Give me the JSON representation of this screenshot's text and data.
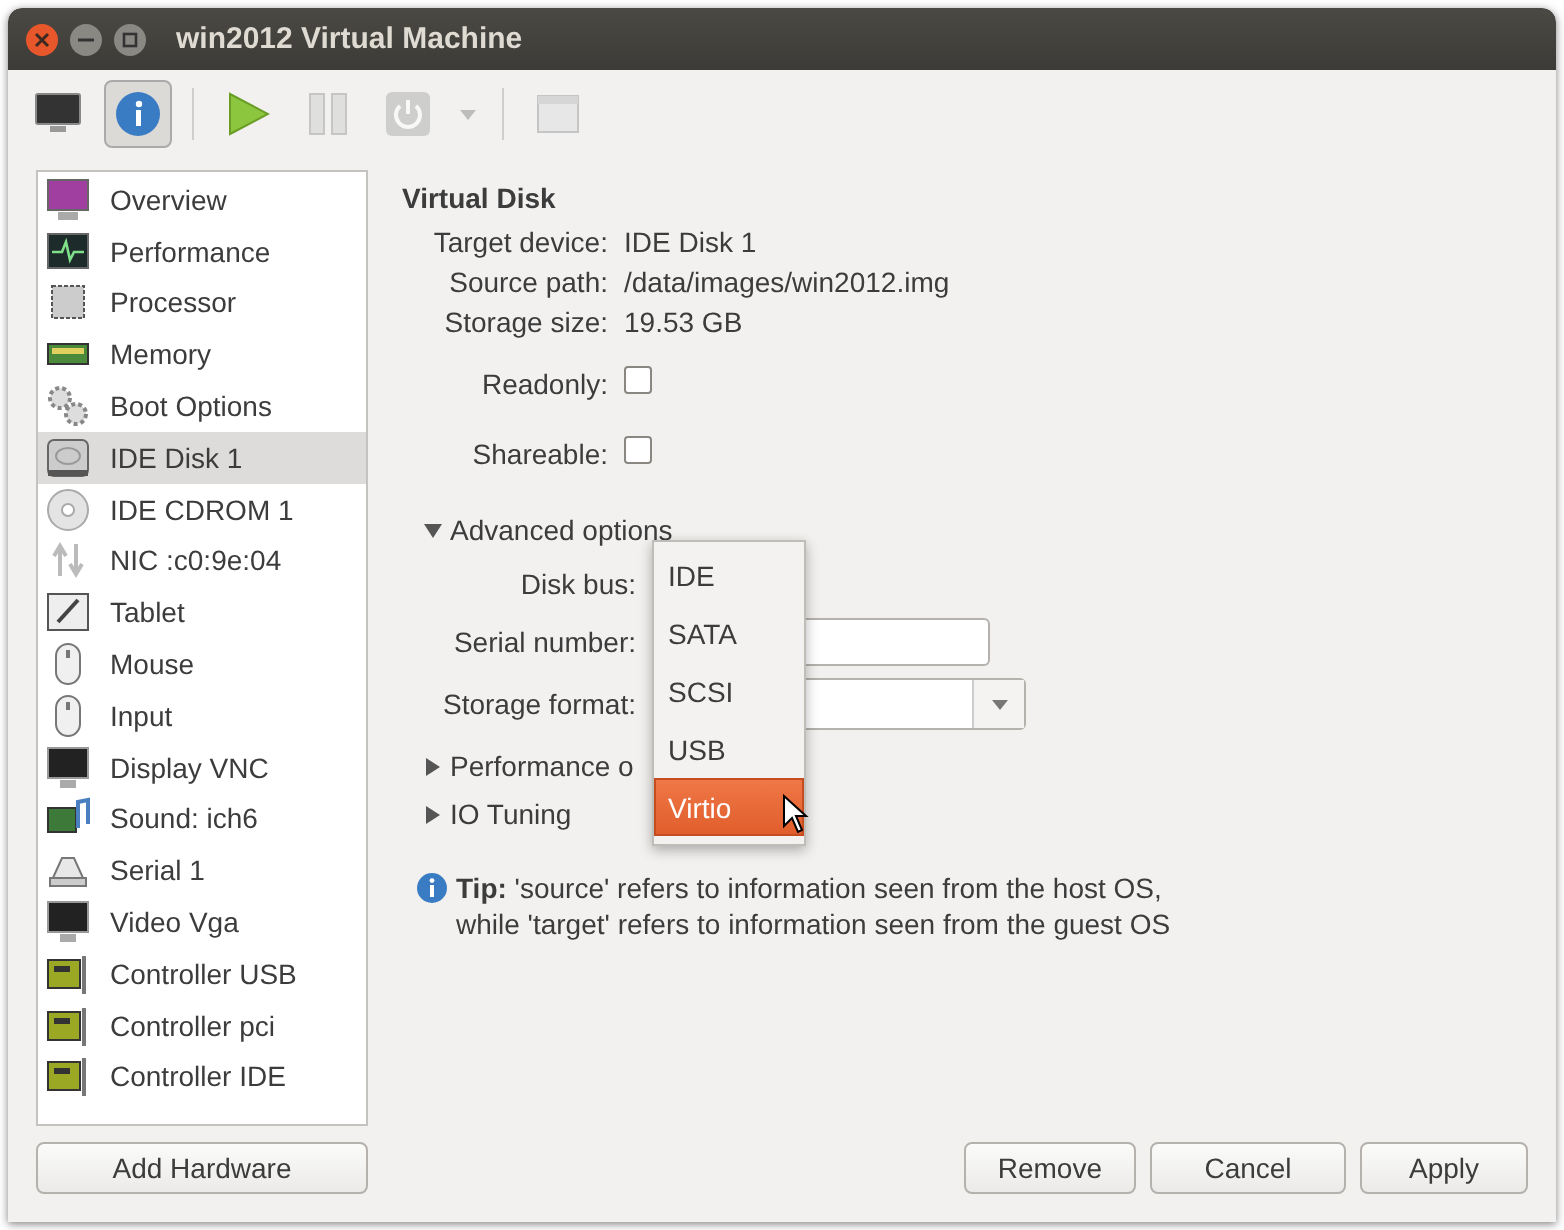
{
  "window": {
    "title": "win2012 Virtual Machine"
  },
  "toolbar": [
    {
      "kind": "console",
      "selected": false,
      "disabled": false
    },
    {
      "kind": "details",
      "selected": true,
      "disabled": false
    },
    {
      "kind": "separator"
    },
    {
      "kind": "run",
      "selected": false,
      "disabled": false
    },
    {
      "kind": "pause",
      "selected": false,
      "disabled": true
    },
    {
      "kind": "shutdown",
      "selected": false,
      "disabled": true
    },
    {
      "kind": "dropdown",
      "selected": false,
      "disabled": true
    },
    {
      "kind": "separator"
    },
    {
      "kind": "fullscreen",
      "selected": false,
      "disabled": true
    }
  ],
  "sidebar": {
    "items": [
      {
        "label": "Overview",
        "kind": "overview",
        "selected": false
      },
      {
        "label": "Performance",
        "kind": "graph",
        "selected": false
      },
      {
        "label": "Processor",
        "kind": "chip",
        "selected": false
      },
      {
        "label": "Memory",
        "kind": "memory",
        "selected": false
      },
      {
        "label": "Boot Options",
        "kind": "gears",
        "selected": false
      },
      {
        "label": "IDE Disk 1",
        "kind": "disk",
        "selected": true
      },
      {
        "label": "IDE CDROM 1",
        "kind": "cd",
        "selected": false
      },
      {
        "label": "NIC :c0:9e:04",
        "kind": "network",
        "selected": false
      },
      {
        "label": "Tablet",
        "kind": "tablet",
        "selected": false
      },
      {
        "label": "Mouse",
        "kind": "mouse",
        "selected": false
      },
      {
        "label": "Input",
        "kind": "mouse",
        "selected": false
      },
      {
        "label": "Display VNC",
        "kind": "monitor",
        "selected": false
      },
      {
        "label": "Sound: ich6",
        "kind": "sound",
        "selected": false
      },
      {
        "label": "Serial 1",
        "kind": "serial",
        "selected": false
      },
      {
        "label": "Video Vga",
        "kind": "monitor",
        "selected": false
      },
      {
        "label": "Controller USB",
        "kind": "card",
        "selected": false
      },
      {
        "label": "Controller pci",
        "kind": "card",
        "selected": false
      },
      {
        "label": "Controller IDE",
        "kind": "card",
        "selected": false
      }
    ],
    "add_button": "Add Hardware"
  },
  "details": {
    "title": "Virtual Disk",
    "fields": [
      {
        "label": "Target device:",
        "value": "IDE Disk 1"
      },
      {
        "label": "Source path:",
        "value": "/data/images/win2012.img"
      },
      {
        "label": "Storage size:",
        "value": "19.53 GB"
      }
    ],
    "checkboxes": [
      {
        "label": "Readonly:",
        "checked": false
      },
      {
        "label": "Shareable:",
        "checked": false
      }
    ],
    "advanced": {
      "label": "Advanced options",
      "expanded": true,
      "disk_bus_label": "Disk bus:",
      "serial_label": "Serial number:",
      "format_label": "Storage format:"
    },
    "expanders": [
      {
        "label": "Performance o",
        "expanded": false
      },
      {
        "label": "IO Tuning",
        "expanded": false
      }
    ],
    "tip": "**Tip:** 'source' refers to information seen from the host OS,\nwhile 'target' refers to information seen from the guest OS"
  },
  "disk_bus_menu": [
    {
      "label": "IDE",
      "selected": false
    },
    {
      "label": "SATA",
      "selected": false
    },
    {
      "label": "SCSI",
      "selected": false
    },
    {
      "label": "USB",
      "selected": false
    },
    {
      "label": "Virtio",
      "selected": true
    }
  ],
  "buttons": [
    "Remove",
    "Cancel",
    "Apply"
  ]
}
